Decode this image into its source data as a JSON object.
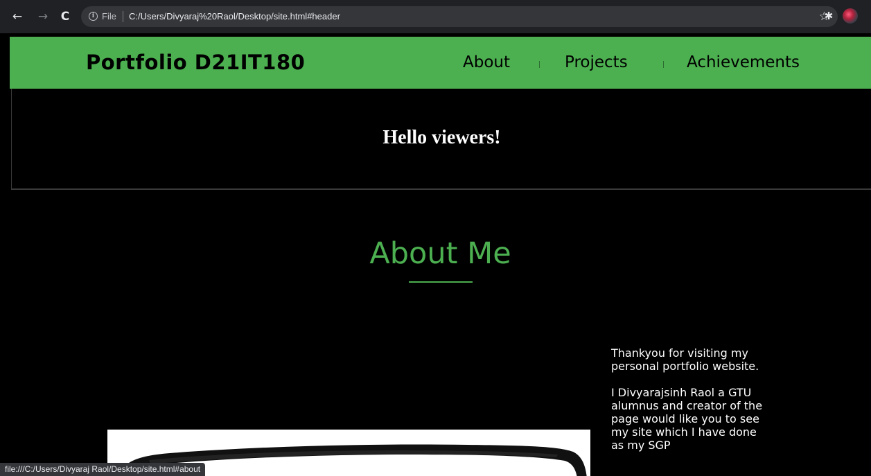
{
  "browser": {
    "back_icon": "←",
    "forward_icon": "→",
    "reload_icon": "C",
    "info_icon": "i",
    "scheme_label": "File",
    "url": "C:/Users/Divyaraj%20Raol/Desktop/site.html#header",
    "bookmark_icon": "☆",
    "extensions_icon": "✱",
    "status_url": "file:///C:/Users/Divyaraj Raol/Desktop/site.html#about"
  },
  "header": {
    "brand": "Portfolio D21IT180",
    "nav": {
      "about": "About",
      "projects": "Projects",
      "achievements": "Achievements"
    },
    "bg_color": "#4caf50"
  },
  "hero": {
    "greeting": "Hello viewers!"
  },
  "about": {
    "title": "About Me",
    "accent_color": "#4caf50",
    "paragraph_1": "Thankyou for visiting my personal portfolio website.",
    "paragraph_2": "I Divyarajsinh Raol a GTU alumnus and creator of the page would like you to see my site which I have done as my SGP"
  }
}
